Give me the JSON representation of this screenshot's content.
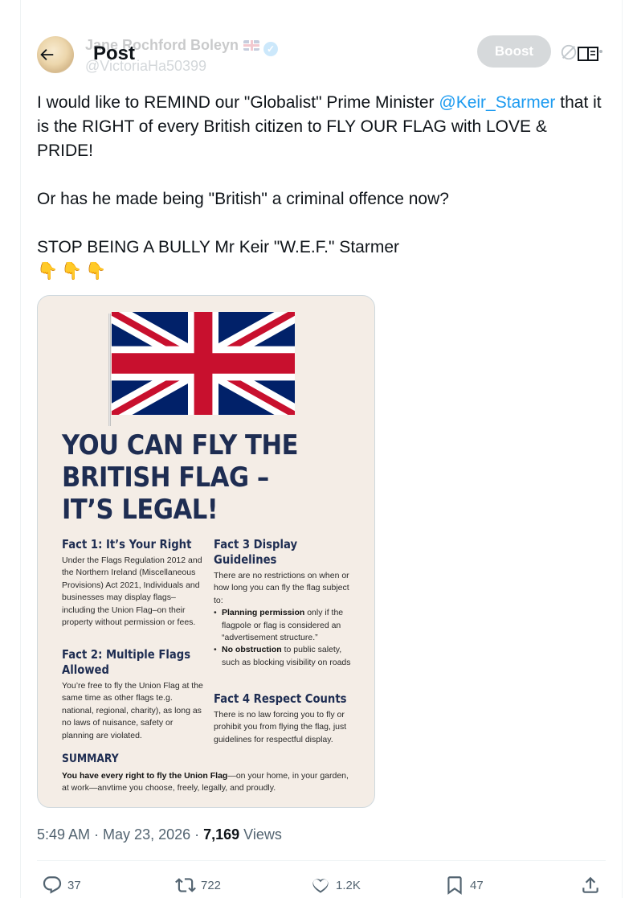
{
  "header": {
    "title": "Post",
    "boost_label": "Boost"
  },
  "author": {
    "name": "Jane Rochford Boleyn",
    "handle": "@VictoriaHa50399"
  },
  "tweet": {
    "line1_pre": "I would like to REMIND our \"Globalist\" Prime Minister ",
    "mention": "@Keir_Starmer",
    "line1_post": " that it is the RIGHT of every British citizen to FLY OUR FLAG with LOVE & PRIDE!",
    "para2": "Or has he made being \"British\" a criminal offence now?",
    "para3": "STOP BEING A BULLY Mr Keir \"W.E.F.\" Starmer",
    "emojis": "👇👇👇"
  },
  "image": {
    "headline": [
      "YOU CAN FLY THE",
      "BRITISH FLAG –",
      "IT’S LEGAL!"
    ],
    "fact1_title": "Fact 1: It’s Your Right",
    "fact1_body": "Under the Flags Regulation 2012 and the Northern Ireland (Miscellaneous Provisions) Act 2021, Individuals and businesses may display flags–including the Union Flag–on their property without permission or fees.",
    "fact2_title": "Fact 2: Multiple Flags Allowed",
    "fact2_body": "You’re free to fly the Union Flag at the same time as other flags te.g. national, regional, charity), as long as no laws of nuisance, safety or planning are violated.",
    "fact3_title": "Fact 3 Display Guidelines",
    "fact3_body": "There are no restrictions on when or how long you can fly the flag subject to:",
    "fact3_b1_bold": "Planning permission",
    "fact3_b1_rest": " only if the flagpole or flag is considered an “advertisement structure.”",
    "fact3_b2_bold": "No obstruction",
    "fact3_b2_rest": " to public salety, such as blocking visibility on roads",
    "fact4_title": "Fact 4 Respect Counts",
    "fact4_body": "There is no law forcing you to fly or prohibit you from flying the flag, just guidelines for respectful display.",
    "summary_title": "SUMMARY",
    "summary_bold": "You have every right to fly the Union Flag",
    "summary_rest": "—on your home, in your garden, at work—anvtime you choose, freely, legally, and proudly."
  },
  "meta": {
    "time": "5:49 AM",
    "sep1": " · ",
    "date": "May 23, 2026",
    "sep2": " · ",
    "views_count": "7,169",
    "views_label": " Views"
  },
  "actions": {
    "replies": "37",
    "reposts": "722",
    "likes": "1.2K",
    "bookmarks": "47"
  },
  "icons": {
    "back": "arrow-left-icon",
    "grok": "grok-icon",
    "reader": "reader-book-icon",
    "reply": "reply-icon",
    "repost": "repost-icon",
    "like": "heart-icon",
    "bookmark": "bookmark-icon",
    "share": "share-icon"
  },
  "colors": {
    "accent": "#1d9bf0",
    "headline_navy": "#1e2d52",
    "union_blue": "#012169",
    "union_red": "#c8102e"
  }
}
